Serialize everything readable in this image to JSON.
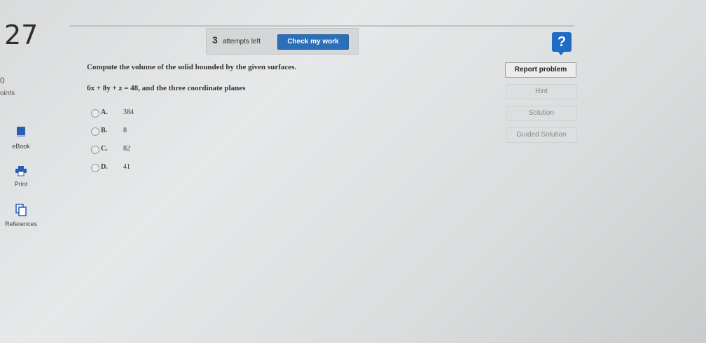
{
  "question": {
    "number": "27",
    "points_value": "0",
    "points_label": "oints"
  },
  "sidebar": {
    "tools": [
      {
        "label": "eBook",
        "icon": "book-icon"
      },
      {
        "label": "Print",
        "icon": "printer-icon"
      },
      {
        "label": "References",
        "icon": "references-icon"
      }
    ]
  },
  "toolbar": {
    "attempts_count": "3",
    "attempts_label": "attempts left",
    "check_label": "Check my work",
    "help_label": "?"
  },
  "problem": {
    "prompt": "Compute the volume of the solid bounded by the given surfaces.",
    "equation": "6x + 8y + z = 48, and the three coordinate planes",
    "options": [
      {
        "letter": "A.",
        "value": "384"
      },
      {
        "letter": "B.",
        "value": "8"
      },
      {
        "letter": "C.",
        "value": "82"
      },
      {
        "letter": "D.",
        "value": "41"
      }
    ]
  },
  "actions": {
    "report_label": "Report problem",
    "hint_label": "Hint",
    "solution_label": "Solution",
    "guided_label": "Guided Solution"
  },
  "colors": {
    "accent": "#2a6fb8",
    "help": "#1f6cc4",
    "background": "#e0e2e3"
  }
}
